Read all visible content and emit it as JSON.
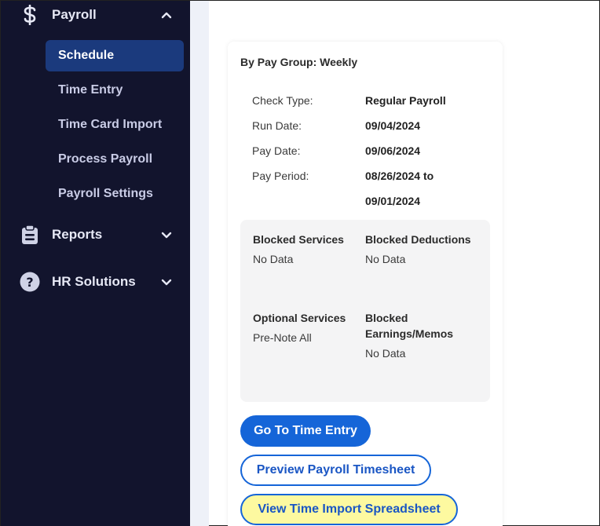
{
  "sidebar": {
    "payroll": {
      "label": "Payroll",
      "icon": "dollar-icon",
      "expanded": true
    },
    "items": [
      {
        "label": "Schedule",
        "active": true
      },
      {
        "label": "Time Entry",
        "active": false
      },
      {
        "label": "Time Card Import",
        "active": false
      },
      {
        "label": "Process Payroll",
        "active": false
      },
      {
        "label": "Payroll Settings",
        "active": false
      }
    ],
    "reports": {
      "label": "Reports",
      "icon": "clipboard-icon",
      "expanded": false
    },
    "hr": {
      "label": "HR Solutions",
      "icon": "question-circle-icon",
      "expanded": false
    }
  },
  "card": {
    "title": "By Pay Group: Weekly",
    "check_type_label": "Check Type:",
    "check_type_value": "Regular Payroll",
    "run_date_label": "Run Date:",
    "run_date_value": "09/04/2024",
    "pay_date_label": "Pay Date:",
    "pay_date_value": "09/06/2024",
    "pay_period_label": "Pay Period:",
    "pay_period_value_1": "08/26/2024 to",
    "pay_period_value_2": "09/01/2024",
    "blocked_services_label": "Blocked Services",
    "blocked_services_value": "No Data",
    "blocked_deductions_label": "Blocked Deductions",
    "blocked_deductions_value": "No Data",
    "optional_services_label": "Optional Services",
    "optional_services_value": "Pre-Note All",
    "blocked_earnings_label_1": "Blocked",
    "blocked_earnings_label_2": "Earnings/Memos",
    "blocked_earnings_value": "No Data"
  },
  "buttons": {
    "time_entry": "Go To Time Entry",
    "preview_timesheet": "Preview Payroll Timesheet",
    "view_import": "View Time Import Spreadsheet"
  },
  "colors": {
    "sidebar_bg": "#12142d",
    "active_item": "#1b3a7d",
    "primary": "#1565d8",
    "highlight": "#fdf9a0"
  }
}
